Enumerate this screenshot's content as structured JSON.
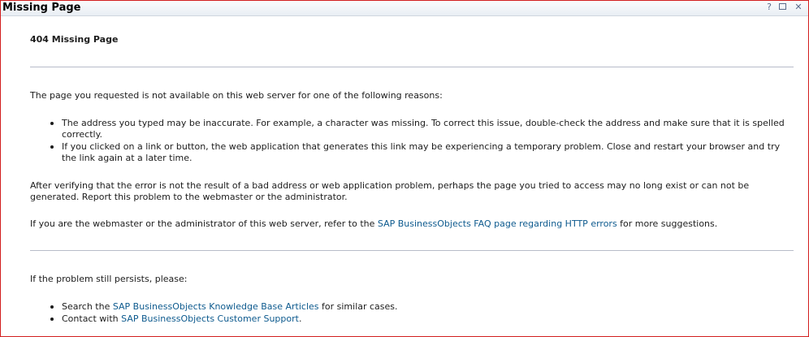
{
  "window": {
    "title": "Missing Page",
    "help": "?",
    "close": "✕"
  },
  "content": {
    "heading": "404 Missing Page",
    "intro": "The page you requested is not available on this web server for one of the following reasons:",
    "reasons": [
      "The address you typed may be inaccurate. For example, a character was missing. To correct this issue, double-check the address and make sure that it is spelled correctly.",
      "If you clicked on a link or button, the web application that generates this link may be experiencing a temporary problem. Close and restart your browser and try the link again at a later time."
    ],
    "verify": "After verifying that the error is not the result of a bad address or web application problem, perhaps the page you tried to access may no long exist or can not be generated. Report this problem to the webmaster or the administrator.",
    "admin_before": "If you are the webmaster or the administrator of this web server, refer to the ",
    "admin_link": "SAP BusinessObjects FAQ page regarding HTTP errors",
    "admin_after": " for more suggestions.",
    "persist": "If the problem still persists, please:",
    "search_before": "Search the ",
    "search_link": "SAP BusinessObjects Knowledge Base Articles",
    "search_after": " for similar cases.",
    "contact_before": "Contact with ",
    "contact_link": "SAP BusinessObjects Customer Support",
    "contact_after": "."
  }
}
